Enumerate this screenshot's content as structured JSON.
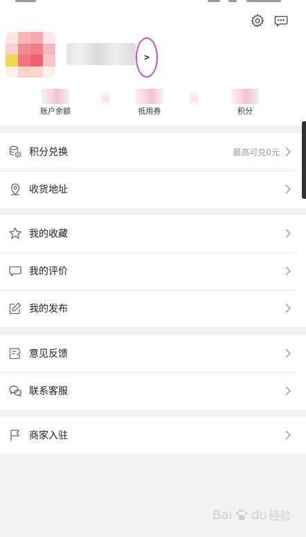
{
  "header": {
    "settings_icon": "gear-icon",
    "message_icon": "chat-bubble-icon",
    "profile_arrow": ">"
  },
  "stats": [
    {
      "label": "账户余额"
    },
    {
      "label": "抵用券"
    },
    {
      "label": "积分"
    }
  ],
  "menu_groups": [
    [
      {
        "icon": "points-exchange-icon",
        "label": "积分兑换",
        "hint": "最高可兑0元"
      },
      {
        "icon": "location-pin-icon",
        "label": "收货地址"
      }
    ],
    [
      {
        "icon": "star-icon",
        "label": "我的收藏"
      },
      {
        "icon": "comment-icon",
        "label": "我的评价"
      },
      {
        "icon": "edit-icon",
        "label": "我的发布"
      }
    ],
    [
      {
        "icon": "feedback-icon",
        "label": "意见反馈"
      },
      {
        "icon": "wechat-icon",
        "label": "联系客服"
      }
    ],
    [
      {
        "icon": "flag-icon",
        "label": "商家入驻"
      }
    ]
  ],
  "watermark": {
    "brand": "Bai",
    "brand2": "du",
    "sub": "经验"
  },
  "colors": {
    "highlight_circle": "#d04ac8",
    "background": "#f2f2f2"
  }
}
